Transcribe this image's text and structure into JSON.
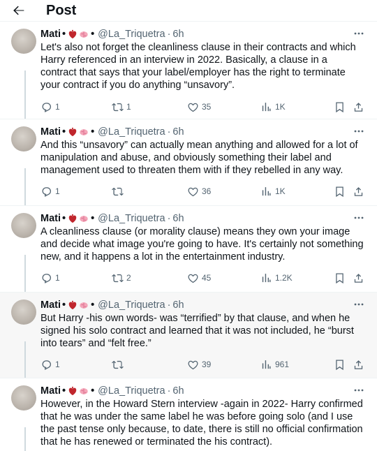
{
  "header": {
    "title": "Post"
  },
  "colors": {
    "text": "#0f1419",
    "secondary": "#536471",
    "divider": "#eff3f4",
    "highlight": "#f7f7f7"
  },
  "icons": [
    "back-arrow-icon",
    "heart-organ-emoji",
    "brain-emoji",
    "more-icon",
    "reply-icon",
    "retweet-icon",
    "like-icon",
    "views-icon",
    "bookmark-icon",
    "share-icon"
  ],
  "tweets": [
    {
      "name": "Mati",
      "handle": "@La_Triquetra",
      "time": "6h",
      "text": "Let's also not forget the cleanliness clause in their contracts and which Harry referenced in an interview in 2022. Basically, a clause in a contract that says that your label/employer has the right to terminate your contract if you do anything “unsavory”.",
      "replies": "1",
      "retweets": "1",
      "likes": "35",
      "views": "1K"
    },
    {
      "name": "Mati",
      "handle": "@La_Triquetra",
      "time": "6h",
      "text": "And this “unsavory” can actually mean anything and allowed for a lot of manipulation and abuse, and obviously something their label and management used to threaten them with if they rebelled in any way.",
      "replies": "1",
      "retweets": "",
      "likes": "36",
      "views": "1K"
    },
    {
      "name": "Mati",
      "handle": "@La_Triquetra",
      "time": "6h",
      "text": "A cleanliness clause (or morality clause) means they own your image and decide what image you're going to have. It's certainly not something new, and it happens a lot in the entertainment industry.",
      "replies": "1",
      "retweets": "2",
      "likes": "45",
      "views": "1.2K"
    },
    {
      "name": "Mati",
      "handle": "@La_Triquetra",
      "time": "6h",
      "text": "But Harry -his own words- was “terrified” by that clause, and when he signed his solo contract and learned that it was not included, he “burst into tears” and “felt free.”",
      "replies": "1",
      "retweets": "",
      "likes": "39",
      "views": "961"
    },
    {
      "name": "Mati",
      "handle": "@La_Triquetra",
      "time": "6h",
      "text": "However, in the Howard Stern interview -again in 2022- Harry confirmed that he was under the same label he was before going solo (and I use the past tense only because, to date, there is still no official confirmation that he has renewed or terminated the his contract)."
    }
  ]
}
